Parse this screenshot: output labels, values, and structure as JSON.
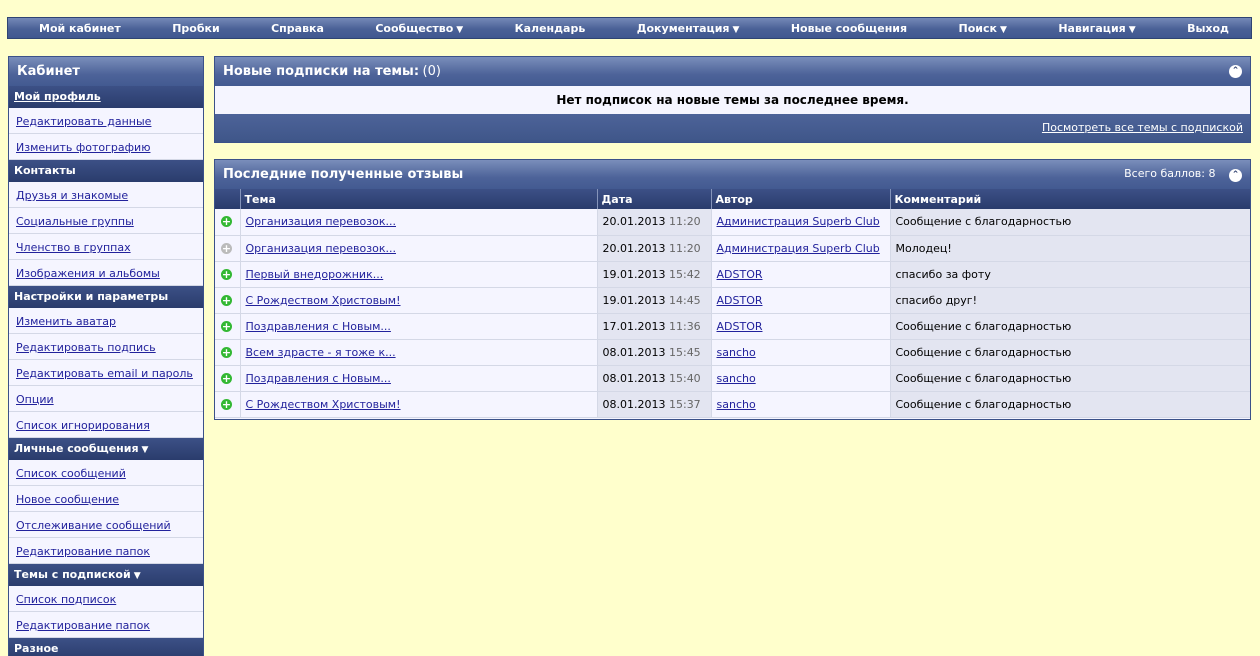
{
  "colors": {
    "positive": "#33b833",
    "neutral": "#bbbbbb"
  },
  "topnav": [
    {
      "label": "Мой кабинет",
      "arrow": false
    },
    {
      "label": "Пробки",
      "arrow": false
    },
    {
      "label": "Справка",
      "arrow": false
    },
    {
      "label": "Сообщество",
      "arrow": true
    },
    {
      "label": "Календарь",
      "arrow": false
    },
    {
      "label": "Документация",
      "arrow": true
    },
    {
      "label": "Новые сообщения",
      "arrow": false
    },
    {
      "label": "Поиск",
      "arrow": true
    },
    {
      "label": "Навигация",
      "arrow": true
    },
    {
      "label": "Выход",
      "arrow": false
    }
  ],
  "sidebar": {
    "title": "Кабинет",
    "active_item": "Мой профиль",
    "sections": [
      {
        "label": "",
        "items": [
          "Редактировать данные",
          "Изменить фотографию"
        ]
      },
      {
        "label": "Контакты",
        "arrow": false,
        "items": [
          "Друзья и знакомые",
          "Социальные группы",
          "Членство в группах",
          "Изображения и альбомы"
        ]
      },
      {
        "label": "Настройки и параметры",
        "arrow": false,
        "items": [
          "Изменить аватар",
          "Редактировать подпись",
          "Редактировать email и пароль",
          "Опции",
          "Список игнорирования"
        ]
      },
      {
        "label": "Личные сообщения",
        "arrow": true,
        "items": [
          "Список сообщений",
          "Новое сообщение",
          "Отслеживание сообщений",
          "Редактирование папок"
        ]
      },
      {
        "label": "Темы с подпиской",
        "arrow": true,
        "items": [
          "Список подписок",
          "Редактирование папок"
        ]
      },
      {
        "label": "Разное",
        "arrow": false,
        "items": []
      }
    ]
  },
  "subscriptions": {
    "title": "Новые подписки на темы:",
    "count": "(0)",
    "message": "Нет подписок на новые темы за последнее время.",
    "view_all_link": "Посмотреть все темы с подпиской"
  },
  "feedback": {
    "title": "Последние полученные отзывы",
    "total": "Всего баллов: 8",
    "columns": [
      "Тема",
      "Дата",
      "Автор",
      "Комментарий"
    ],
    "rows": [
      {
        "icon": "positive",
        "topic": "Организация перевозок...",
        "date": "20.01.2013",
        "time": "11:20",
        "author": "Администрация Superb Club",
        "comment": "Сообщение с благодарностью"
      },
      {
        "icon": "neutral",
        "topic": "Организация перевозок...",
        "date": "20.01.2013",
        "time": "11:20",
        "author": "Администрация Superb Club",
        "comment": "Молодец!"
      },
      {
        "icon": "positive",
        "topic": "Первый внедорожник...",
        "date": "19.01.2013",
        "time": "15:42",
        "author": "ADSTOR",
        "comment": "спасибо за фоту"
      },
      {
        "icon": "positive",
        "topic": "С Рождеством Христовым!",
        "date": "19.01.2013",
        "time": "14:45",
        "author": "ADSTOR",
        "comment": "спасибо друг!"
      },
      {
        "icon": "positive",
        "topic": "Поздравления с Новым...",
        "date": "17.01.2013",
        "time": "11:36",
        "author": "ADSTOR",
        "comment": "Сообщение с благодарностью"
      },
      {
        "icon": "positive",
        "topic": "Всем здрасте - я тоже к...",
        "date": "08.01.2013",
        "time": "15:45",
        "author": "sancho",
        "comment": "Сообщение с благодарностью"
      },
      {
        "icon": "positive",
        "topic": "Поздравления с Новым...",
        "date": "08.01.2013",
        "time": "15:40",
        "author": "sancho",
        "comment": "Сообщение с благодарностью"
      },
      {
        "icon": "positive",
        "topic": "С Рождеством Христовым!",
        "date": "08.01.2013",
        "time": "15:37",
        "author": "sancho",
        "comment": "Сообщение с благодарностью"
      }
    ]
  }
}
